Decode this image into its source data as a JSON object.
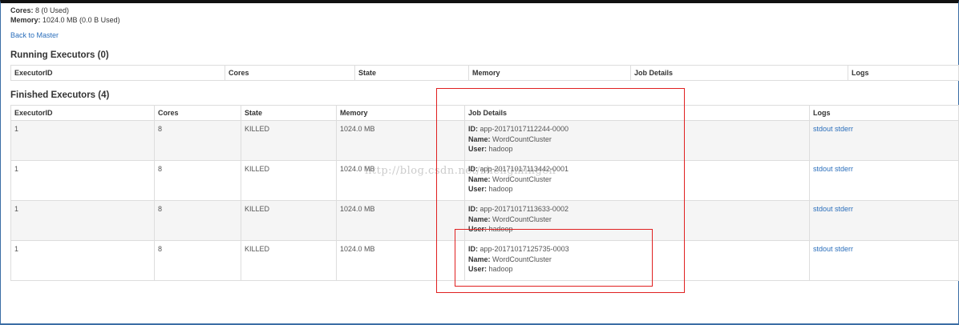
{
  "summary": {
    "cores_label": "Cores:",
    "cores_value": "8 (0 Used)",
    "memory_label": "Memory:",
    "memory_value": "1024.0 MB (0.0 B Used)",
    "back_link": "Back to Master"
  },
  "running": {
    "title": "Running Executors (0)",
    "headers": [
      "ExecutorID",
      "Cores",
      "State",
      "Memory",
      "Job Details",
      "Logs"
    ]
  },
  "finished": {
    "title": "Finished Executors (4)",
    "headers": [
      "ExecutorID",
      "Cores",
      "State",
      "Memory",
      "Job Details",
      "Logs"
    ],
    "id_label": "ID:",
    "name_label": "Name:",
    "user_label": "User:",
    "rows": [
      {
        "executor_id": "1",
        "cores": "8",
        "state": "KILLED",
        "memory": "1024.0 MB",
        "app_id": "app-20171017112244-0000",
        "name": "WordCountCluster",
        "user": "hadoop",
        "stdout": "stdout",
        "stderr": "stderr"
      },
      {
        "executor_id": "1",
        "cores": "8",
        "state": "KILLED",
        "memory": "1024.0 MB",
        "app_id": "app-20171017113442-0001",
        "name": "WordCountCluster",
        "user": "hadoop",
        "stdout": "stdout",
        "stderr": "stderr"
      },
      {
        "executor_id": "1",
        "cores": "8",
        "state": "KILLED",
        "memory": "1024.0 MB",
        "app_id": "app-20171017113633-0002",
        "name": "WordCountCluster",
        "user": "hadoop",
        "stdout": "stdout",
        "stderr": "stderr"
      },
      {
        "executor_id": "1",
        "cores": "8",
        "state": "KILLED",
        "memory": "1024.0 MB",
        "app_id": "app-20171017125735-0003",
        "name": "WordCountCluster",
        "user": "hadoop",
        "stdout": "stdout",
        "stderr": "stderr"
      }
    ]
  },
  "watermark": "http://blog.csdn.net/zhengmingen",
  "colors": {
    "link": "#2a6ebb",
    "highlight": "#e02020",
    "stripe": "#f5f5f5"
  }
}
